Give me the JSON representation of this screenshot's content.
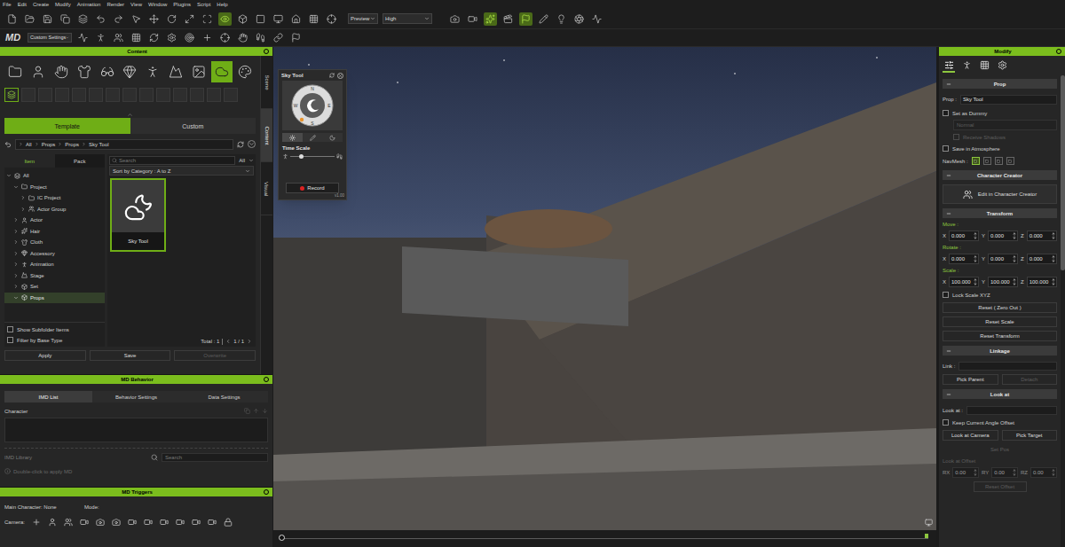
{
  "menu": [
    "File",
    "Edit",
    "Create",
    "Modify",
    "Animation",
    "Render",
    "View",
    "Window",
    "Plugins",
    "Script",
    "Help"
  ],
  "toolbar": {
    "buttons_before": [
      {
        "active": false
      },
      {
        "active": false
      },
      {
        "active": false
      },
      {
        "active": false
      },
      {
        "active": false
      },
      {
        "active": false
      },
      {
        "active": false
      },
      {
        "active": false
      },
      {
        "active": false
      },
      {
        "active": false
      },
      {
        "active": false
      },
      {
        "active": false
      },
      {
        "active": true
      },
      {
        "active": false
      },
      {
        "active": false
      },
      {
        "active": false
      },
      {
        "active": false
      },
      {
        "active": false
      },
      {
        "active": false
      }
    ],
    "preview": "Preview",
    "quality": "High",
    "buttons_after": [
      {
        "active": false
      },
      {
        "active": false
      },
      {
        "active": true
      },
      {
        "active": false
      },
      {
        "active": true
      },
      {
        "active": false
      },
      {
        "active": false
      },
      {
        "active": false
      },
      {
        "active": false
      }
    ],
    "logo": "MD",
    "preset": "Custom Settings",
    "buttons_row2": [
      {
        "active": false
      },
      {
        "active": false
      },
      {
        "active": false
      },
      {
        "active": false
      },
      {
        "active": false
      },
      {
        "active": false
      },
      {
        "active": false
      },
      {
        "active": false
      },
      {
        "active": false
      },
      {
        "active": false
      },
      {
        "active": false
      },
      {
        "active": false
      },
      {
        "active": false
      }
    ]
  },
  "content": {
    "title": "Content",
    "type_tabs": [
      {
        "selected": false
      },
      {
        "selected": false
      },
      {
        "selected": false
      },
      {
        "selected": false
      },
      {
        "selected": false
      },
      {
        "selected": false
      },
      {
        "selected": false
      },
      {
        "selected": false
      },
      {
        "selected": false
      },
      {
        "selected": true
      },
      {
        "selected": false
      }
    ],
    "sub_slots": [
      {
        "filled": true
      },
      {
        "filled": false
      },
      {
        "filled": false
      },
      {
        "filled": false
      },
      {
        "filled": false
      },
      {
        "filled": false
      },
      {
        "filled": false
      },
      {
        "filled": false
      },
      {
        "filled": false
      },
      {
        "filled": false
      },
      {
        "filled": false
      },
      {
        "filled": false
      },
      {
        "filled": false
      },
      {
        "filled": false
      }
    ],
    "tabs": [
      {
        "label": "Template",
        "selected": true
      },
      {
        "label": "Custom",
        "selected": false
      }
    ],
    "breadcrumb": [
      "All",
      "Props",
      "Props",
      "Sky Tool"
    ],
    "view_tabs": [
      {
        "label": "Item",
        "selected": true
      },
      {
        "label": "Pack",
        "selected": false
      }
    ],
    "tree": [
      {
        "label": "All",
        "depth": 0,
        "expandable": true,
        "expanded": true,
        "selected": false
      },
      {
        "label": "Project",
        "depth": 1,
        "expandable": true,
        "expanded": true,
        "selected": false
      },
      {
        "label": "IC Project",
        "depth": 2,
        "expandable": true,
        "expanded": false,
        "selected": false
      },
      {
        "label": "Actor Group",
        "depth": 2,
        "expandable": true,
        "expanded": false,
        "selected": false
      },
      {
        "label": "Actor",
        "depth": 1,
        "expandable": true,
        "expanded": false,
        "selected": false
      },
      {
        "label": "Hair",
        "depth": 1,
        "expandable": true,
        "expanded": false,
        "selected": false
      },
      {
        "label": "Cloth",
        "depth": 1,
        "expandable": true,
        "expanded": false,
        "selected": false
      },
      {
        "label": "Accessory",
        "depth": 1,
        "expandable": true,
        "expanded": false,
        "selected": false
      },
      {
        "label": "Animation",
        "depth": 1,
        "expandable": true,
        "expanded": false,
        "selected": false
      },
      {
        "label": "Stage",
        "depth": 1,
        "expandable": true,
        "expanded": false,
        "selected": false
      },
      {
        "label": "Set",
        "depth": 1,
        "expandable": true,
        "expanded": false,
        "selected": false
      },
      {
        "label": "Props",
        "depth": 1,
        "expandable": true,
        "expanded": true,
        "selected": true
      }
    ],
    "options": [
      {
        "label": "Show Subfolder Items",
        "checked": false
      },
      {
        "label": "Filter by Base Type",
        "checked": false
      }
    ],
    "search_placeholder": "Search",
    "filter": "All",
    "sort": "Sort by Category : A to Z",
    "items": [
      {
        "label": "Sky Tool",
        "selected": true
      }
    ],
    "total": "Total : 1",
    "pages": "1 / 1",
    "buttons": [
      {
        "label": "Apply",
        "disabled": false
      },
      {
        "label": "Save",
        "disabled": false
      },
      {
        "label": "Overwrite",
        "disabled": true
      }
    ],
    "side_tabs": [
      {
        "label": "Scene",
        "selected": false
      },
      {
        "label": "Content",
        "selected": true
      },
      {
        "label": "Visual",
        "selected": false
      }
    ]
  },
  "md_behavior": {
    "title": "MD Behavior",
    "tabs": [
      {
        "label": "IMD List",
        "selected": true
      },
      {
        "label": "Behavior Settings",
        "selected": false
      },
      {
        "label": "Data Settings",
        "selected": false
      }
    ],
    "character_label": "Character",
    "library_label": "IMD Library",
    "search_placeholder": "Search",
    "hint": "Double-click to apply MD"
  },
  "md_triggers": {
    "title": "MD Triggers",
    "main_character": "Main Character: None",
    "mode": "Mode:",
    "camera": "Camera:",
    "camera_buttons": [
      {
        "active": false
      },
      {
        "active": false
      },
      {
        "active": false
      },
      {
        "active": false
      },
      {
        "active": false
      },
      {
        "active": false
      },
      {
        "active": false
      },
      {
        "active": false
      },
      {
        "active": false
      },
      {
        "active": false
      },
      {
        "active": false
      },
      {
        "active": false
      },
      {
        "active": false
      }
    ]
  },
  "sky_tool": {
    "title": "Sky Tool",
    "compass": [
      "N",
      "W",
      "E",
      "S"
    ],
    "tabs": [
      {
        "selected": true
      },
      {
        "selected": false
      },
      {
        "selected": false
      }
    ],
    "time_scale_label": "Time Scale",
    "time_scale_level": 0.2,
    "record": "Record",
    "version": "v1.00"
  },
  "viewport": {
    "timeline_level": 0
  },
  "modify": {
    "title": "Modify",
    "tabs": [
      {
        "selected": true
      },
      {
        "selected": false
      },
      {
        "selected": false
      },
      {
        "selected": false
      }
    ],
    "prop_section": "Prop",
    "prop_label": "Prop :",
    "prop_value": "Sky Tool",
    "set_as_dummy": {
      "label": "Set as Dummy",
      "checked": false
    },
    "dummy_mode": {
      "value": "Normal",
      "disabled": true
    },
    "receive_shadows": {
      "label": "Receive Shadows",
      "checked": false,
      "disabled": true
    },
    "save_in_atmosphere": {
      "label": "Save in Atmosphere",
      "checked": false
    },
    "navmesh_label": "NavMesh :",
    "navmesh_buttons": [
      {
        "selected": true
      },
      {
        "selected": false
      },
      {
        "selected": false
      },
      {
        "selected": false
      }
    ],
    "cc_section": "Character Creator",
    "cc_button": "Edit in Character Creator",
    "transform_section": "Transform",
    "transform": [
      {
        "label": "Move :",
        "fields": [
          {
            "axis": "X",
            "value": "0.000"
          },
          {
            "axis": "Y",
            "value": "0.000"
          },
          {
            "axis": "Z",
            "value": "0.000"
          }
        ]
      },
      {
        "label": "Rotate :",
        "fields": [
          {
            "axis": "X",
            "value": "0.000"
          },
          {
            "axis": "Y",
            "value": "0.000"
          },
          {
            "axis": "Z",
            "value": "0.000"
          }
        ]
      },
      {
        "label": "Scale :",
        "fields": [
          {
            "axis": "X",
            "value": "100.000"
          },
          {
            "axis": "Y",
            "value": "100.000"
          },
          {
            "axis": "Z",
            "value": "100.000"
          }
        ]
      }
    ],
    "lock_scale": {
      "label": "Lock Scale XYZ",
      "checked": false
    },
    "reset_buttons": [
      "Reset ( Zero Out )",
      "Reset Scale",
      "Reset Transform"
    ],
    "linkage_section": "Linkage",
    "link_label": "Link :",
    "link_buttons": [
      {
        "label": "Pick Parent",
        "disabled": false
      },
      {
        "label": "Detach",
        "disabled": true
      }
    ],
    "look_section": "Look at",
    "look_label": "Look at :",
    "keep_offset": {
      "label": "Keep Current Angle Offset",
      "checked": false
    },
    "look_buttons": [
      {
        "label": "Look at Camera",
        "disabled": false
      },
      {
        "label": "Pick Target",
        "disabled": false
      }
    ],
    "set_pos": {
      "label": "Set Pos",
      "disabled": true
    },
    "offset_label": "Look at Offset",
    "offset_fields": [
      {
        "axis": "RX",
        "value": "0.00"
      },
      {
        "axis": "RY",
        "value": "0.00"
      },
      {
        "axis": "RZ",
        "value": "0.00"
      }
    ],
    "reset_offset": {
      "label": "Reset Offset",
      "disabled": true
    }
  }
}
